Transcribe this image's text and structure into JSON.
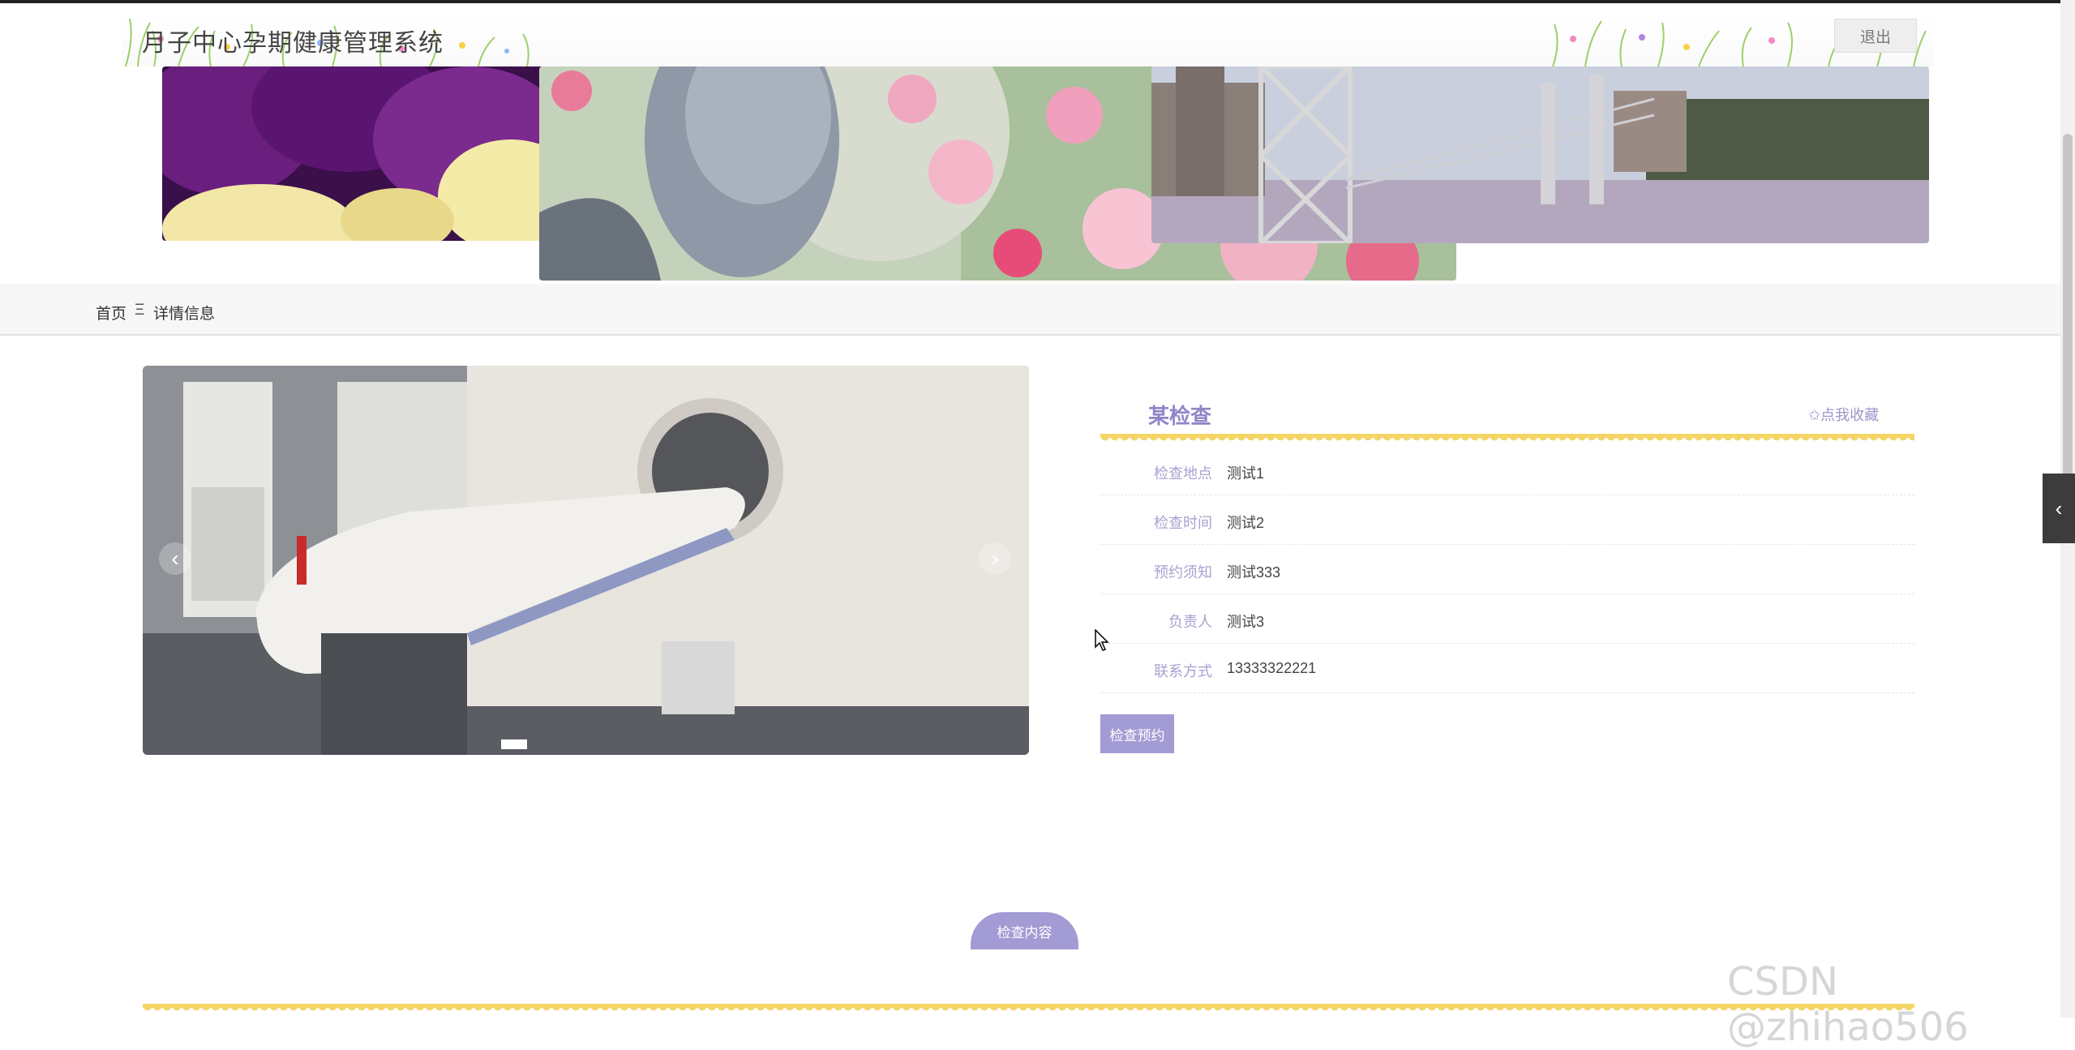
{
  "header": {
    "site_title": "月子中心孕期健康管理系统",
    "logout_label": "退出"
  },
  "breadcrumb": {
    "home": "首页",
    "separator": "Ξ",
    "current": "详情信息"
  },
  "banner": {
    "slide_count": 3,
    "active_index": 1
  },
  "gallery": {
    "prev_icon": "‹",
    "next_icon": "›",
    "indicator_count": 1
  },
  "detail": {
    "title": "某检查",
    "favorite_label": "✩点我收藏",
    "fields": [
      {
        "label": "检查地点",
        "value": "测试1"
      },
      {
        "label": "检查时间",
        "value": "测试2"
      },
      {
        "label": "预约须知",
        "value": "测试333"
      },
      {
        "label": "负责人",
        "value": "测试3"
      },
      {
        "label": "联系方式",
        "value": "13333322221"
      }
    ],
    "book_button": "检查预约"
  },
  "content_tab": {
    "label": "检查内容"
  },
  "side_tab": {
    "icon": "‹"
  },
  "watermark": "CSDN @zhihao506",
  "colors": {
    "accent": "#a29bd4",
    "accent_text": "#8e86c6",
    "scallop": "#f5d565"
  }
}
